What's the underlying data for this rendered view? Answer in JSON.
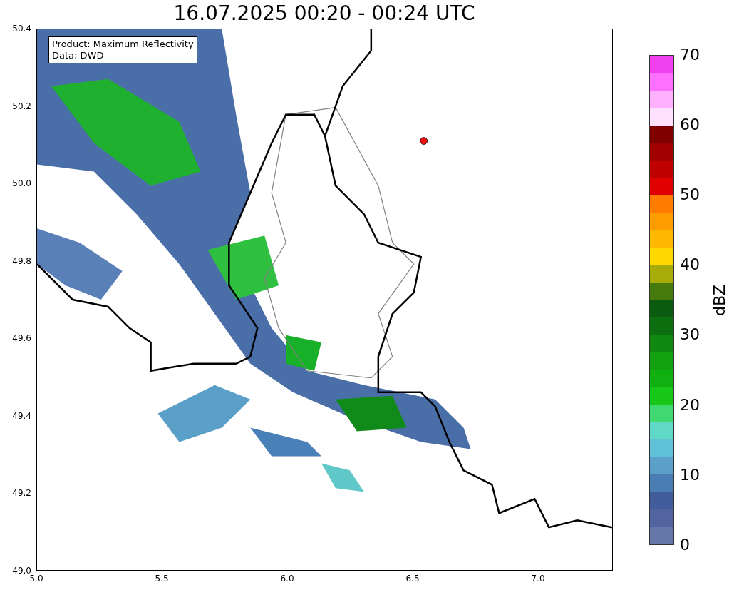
{
  "title": "16.07.2025 00:20 - 00:24 UTC",
  "map": {
    "info_lines": [
      "Product: Maximum Reflectivity",
      "Data: DWD"
    ],
    "x_ticks": [
      "5.0",
      "5.5",
      "6.0",
      "6.5",
      "7.0"
    ],
    "y_ticks": [
      "50.4",
      "50.2",
      "50.0",
      "49.8",
      "49.6",
      "49.4",
      "49.2",
      "49.0"
    ]
  },
  "colorbar": {
    "label": "dBZ",
    "ticks": [
      "70",
      "60",
      "50",
      "40",
      "30",
      "20",
      "10",
      "0"
    ],
    "bins": [
      {
        "color": "#6577a8"
      },
      {
        "color": "#52649f"
      },
      {
        "color": "#425c9c"
      },
      {
        "color": "#4a7db3"
      },
      {
        "color": "#5aa0c8"
      },
      {
        "color": "#60c0d8"
      },
      {
        "color": "#60d8c8"
      },
      {
        "color": "#40d870"
      },
      {
        "color": "#18c818"
      },
      {
        "color": "#10b010"
      },
      {
        "color": "#10a010"
      },
      {
        "color": "#108810"
      },
      {
        "color": "#0c7010"
      },
      {
        "color": "#0a5a10"
      },
      {
        "color": "#467a0c"
      },
      {
        "color": "#a8ac08"
      },
      {
        "color": "#ffd800"
      },
      {
        "color": "#ffb800"
      },
      {
        "color": "#ff9c00"
      },
      {
        "color": "#ff7c00"
      },
      {
        "color": "#e00000"
      },
      {
        "color": "#c00000"
      },
      {
        "color": "#a00000"
      },
      {
        "color": "#800000"
      },
      {
        "color": "#ffe0ff"
      },
      {
        "color": "#ffb0ff"
      },
      {
        "color": "#ff70ff"
      },
      {
        "color": "#f040f0"
      }
    ]
  }
}
